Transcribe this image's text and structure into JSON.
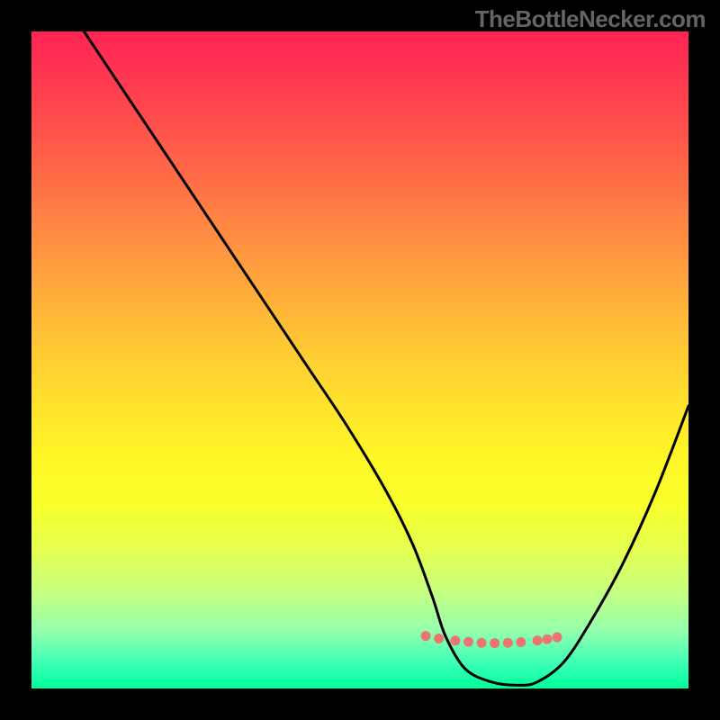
{
  "watermark": "TheBottleNecker.com",
  "chart_data": {
    "type": "line",
    "title": "",
    "xlabel": "",
    "ylabel": "",
    "xlim": [
      0,
      100
    ],
    "ylim": [
      0,
      100
    ],
    "grid": false,
    "series": [
      {
        "name": "bottleneck-curve",
        "x": [
          8,
          12,
          18,
          24,
          30,
          36,
          42,
          48,
          54,
          58,
          61,
          63,
          66,
          70,
          74,
          77,
          81,
          85,
          90,
          95,
          100
        ],
        "values": [
          100,
          94,
          85,
          76,
          67,
          58,
          49,
          40,
          30,
          22,
          14,
          8,
          3,
          1,
          0.5,
          1,
          4,
          10,
          19,
          30,
          43
        ]
      },
      {
        "name": "highlight-dots",
        "x": [
          60,
          62,
          64.5,
          66.5,
          68.5,
          70.5,
          72.5,
          74.5,
          77,
          78.5,
          80
        ],
        "values": [
          8,
          7.6,
          7.3,
          7.1,
          6.95,
          6.9,
          6.95,
          7.05,
          7.3,
          7.5,
          7.8
        ]
      }
    ],
    "colors": {
      "curve": "#000000",
      "dots": "#e97670",
      "gradient_top": "#ff2355",
      "gradient_bottom": "#00ff9a"
    }
  }
}
